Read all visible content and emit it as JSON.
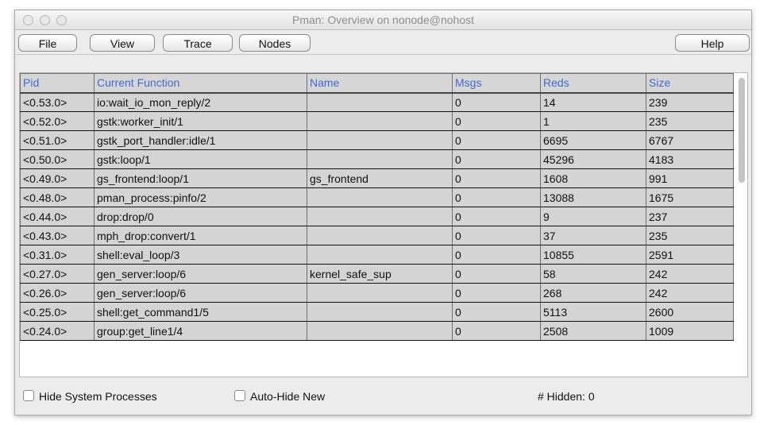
{
  "window": {
    "title": "Pman: Overview on nonode@nohost"
  },
  "menubar": {
    "file": "File",
    "view": "View",
    "trace": "Trace",
    "nodes": "Nodes",
    "help": "Help"
  },
  "table": {
    "columns": [
      "Pid",
      "Current Function",
      "Name",
      "Msgs",
      "Reds",
      "Size"
    ],
    "rows": [
      [
        "<0.53.0>",
        "io:wait_io_mon_reply/2",
        "",
        "0",
        "14",
        "239"
      ],
      [
        "<0.52.0>",
        "gstk:worker_init/1",
        "",
        "0",
        "1",
        "235"
      ],
      [
        "<0.51.0>",
        "gstk_port_handler:idle/1",
        "",
        "0",
        "6695",
        "6767"
      ],
      [
        "<0.50.0>",
        "gstk:loop/1",
        "",
        "0",
        "45296",
        "4183"
      ],
      [
        "<0.49.0>",
        "gs_frontend:loop/1",
        "gs_frontend",
        "0",
        "1608",
        "991"
      ],
      [
        "<0.48.0>",
        "pman_process:pinfo/2",
        "",
        "0",
        "13088",
        "1675"
      ],
      [
        "<0.44.0>",
        "drop:drop/0",
        "",
        "0",
        "9",
        "237"
      ],
      [
        "<0.43.0>",
        "mph_drop:convert/1",
        "",
        "0",
        "37",
        "235"
      ],
      [
        "<0.31.0>",
        "shell:eval_loop/3",
        "",
        "0",
        "10855",
        "2591"
      ],
      [
        "<0.27.0>",
        "gen_server:loop/6",
        "kernel_safe_sup",
        "0",
        "58",
        "242"
      ],
      [
        "<0.26.0>",
        "gen_server:loop/6",
        "",
        "0",
        "268",
        "242"
      ],
      [
        "<0.25.0>",
        "shell:get_command1/5",
        "",
        "0",
        "5113",
        "2600"
      ],
      [
        "<0.24.0>",
        "group:get_line1/4",
        "",
        "0",
        "2508",
        "1009"
      ]
    ]
  },
  "footer": {
    "hide_system_processes": "Hide System Processes",
    "auto_hide_new": "Auto-Hide New",
    "hidden_count": "# Hidden: 0"
  }
}
